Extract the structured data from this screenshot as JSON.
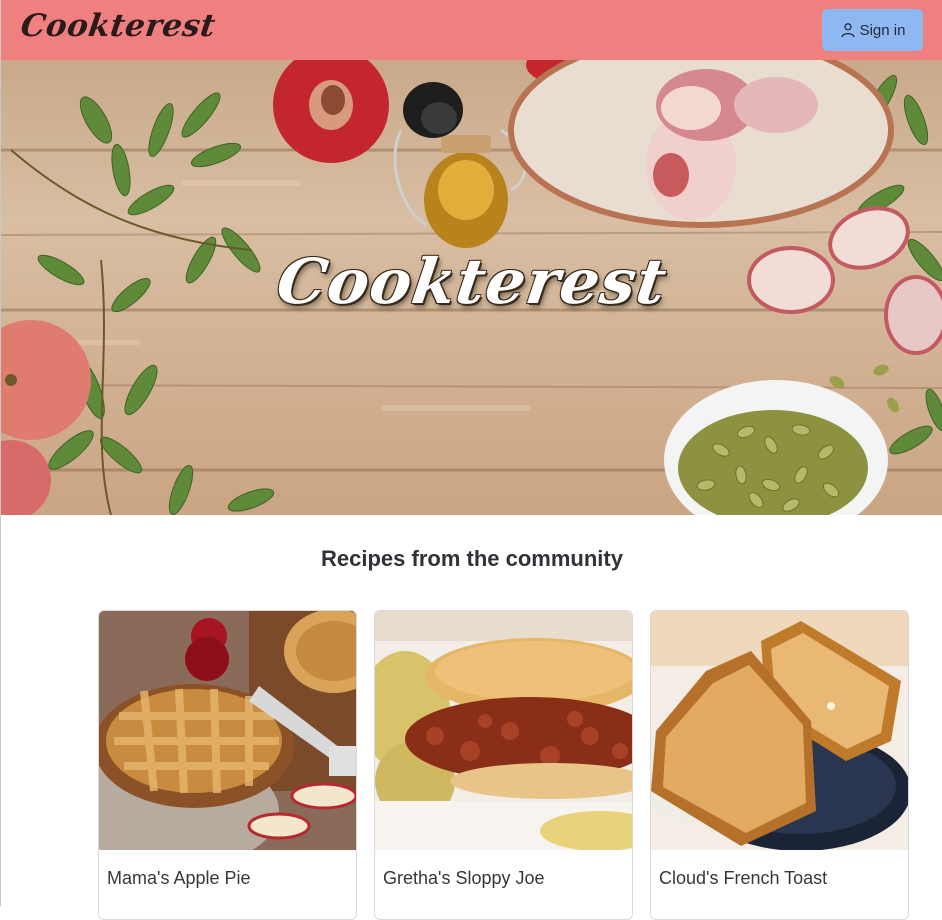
{
  "navbar": {
    "brand": "Cookterest",
    "signin_label": "Sign in",
    "background_color": "#f08080",
    "signin_color": "#8fb8f2"
  },
  "hero": {
    "title": "Cookterest"
  },
  "community": {
    "heading": "Recipes from the community",
    "recipes": [
      {
        "title": "Mama's Apple Pie"
      },
      {
        "title": "Gretha's Sloppy Joe"
      },
      {
        "title": "Cloud's French Toast"
      }
    ]
  },
  "icons": {
    "signin_icon": "person-icon"
  }
}
